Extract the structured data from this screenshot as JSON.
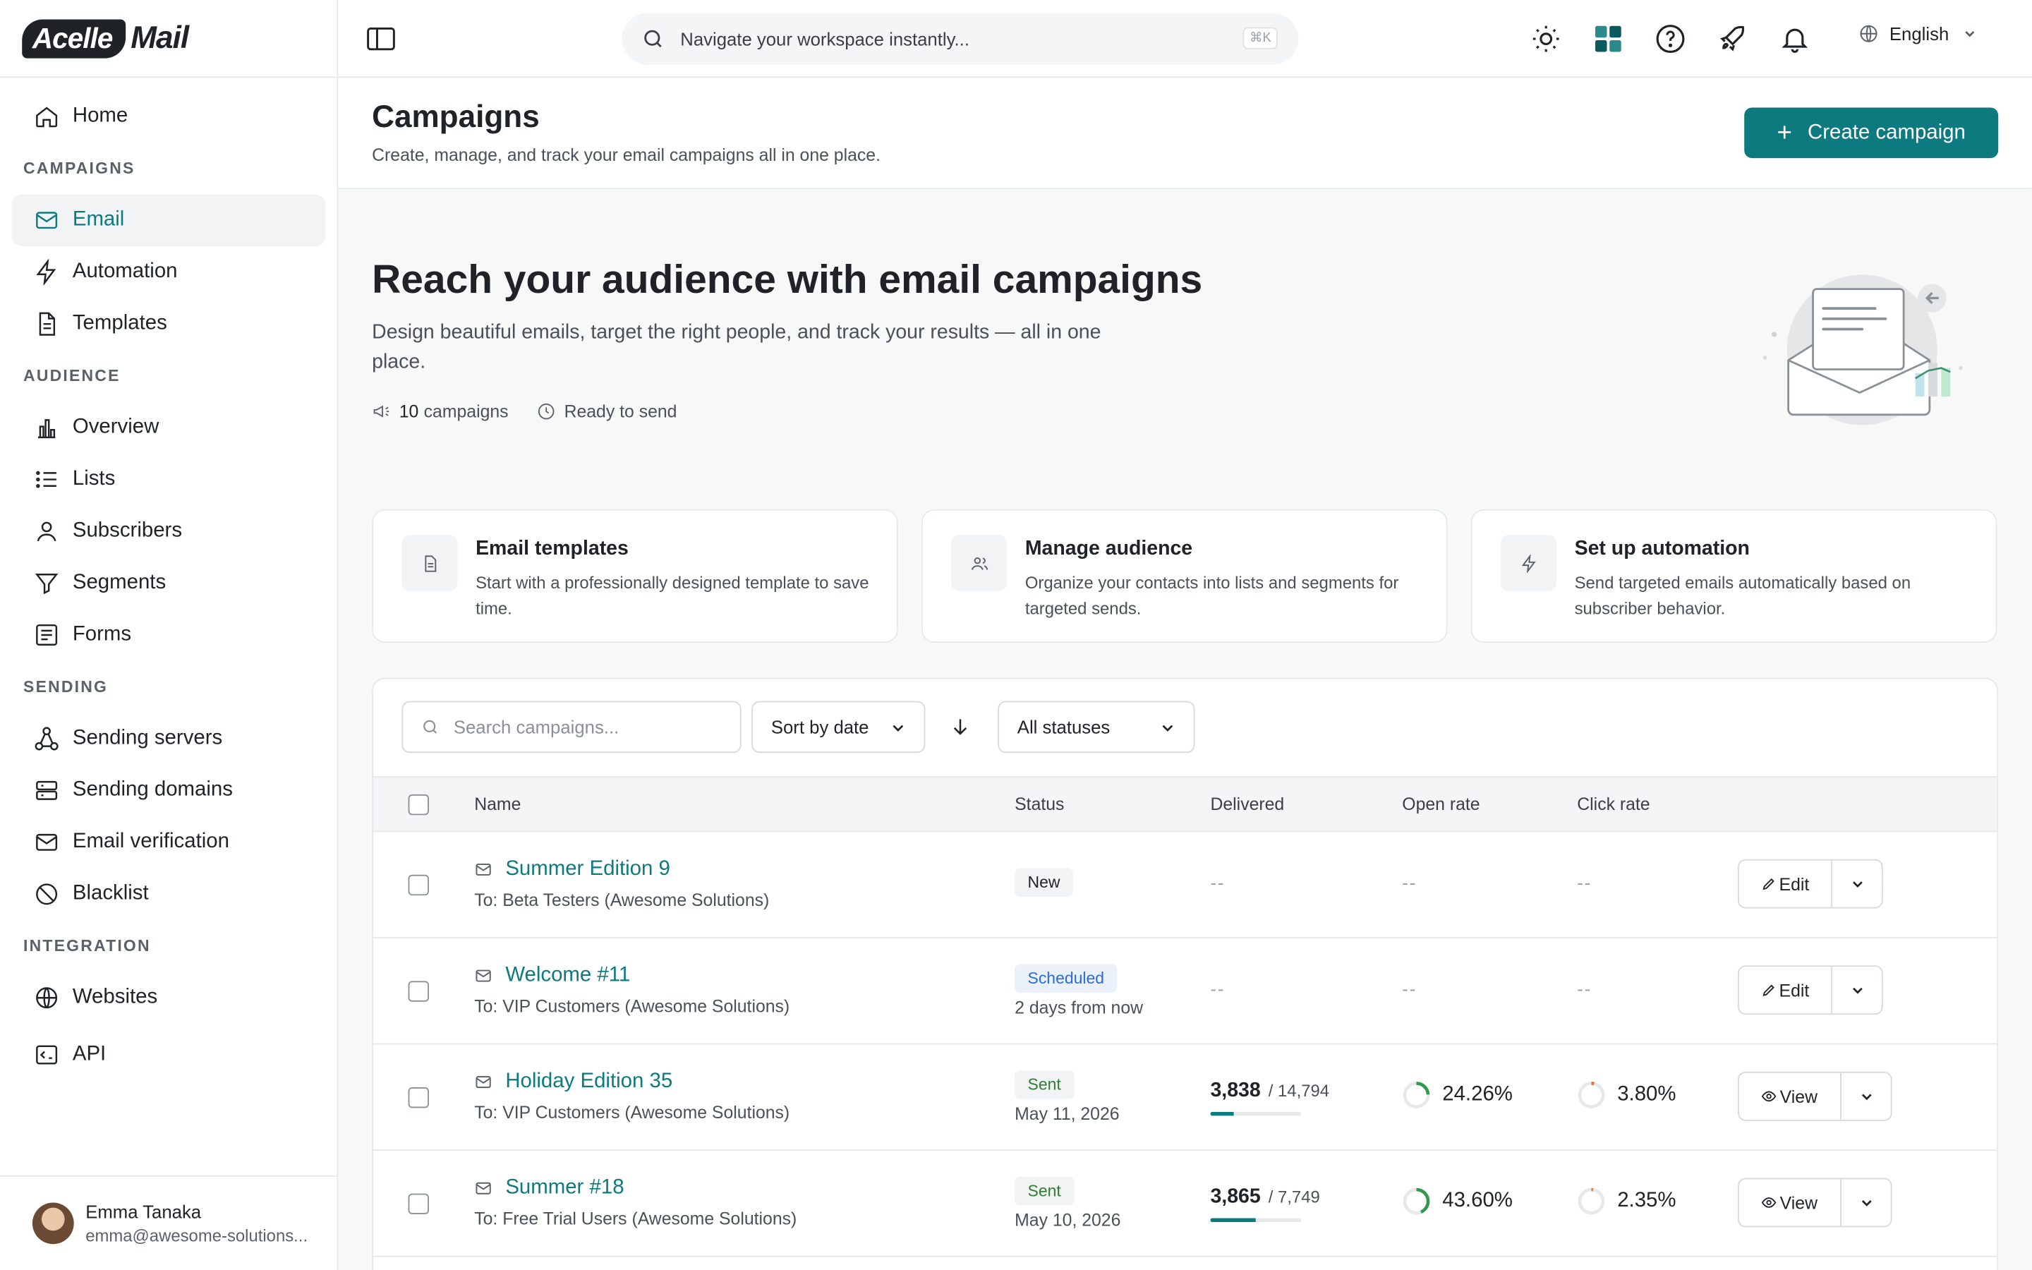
{
  "brand": {
    "logo_badge": "Acelle",
    "logo_text": "Mail"
  },
  "sidebar": {
    "home": "Home",
    "sections": {
      "campaigns": "CAMPAIGNS",
      "audience": "AUDIENCE",
      "sending": "SENDING",
      "integration": "INTEGRATION"
    },
    "campaigns": [
      "Email",
      "Automation",
      "Templates"
    ],
    "audience": [
      "Overview",
      "Lists",
      "Subscribers",
      "Segments",
      "Forms"
    ],
    "sending": [
      "Sending servers",
      "Sending domains",
      "Email verification",
      "Blacklist"
    ],
    "integration": [
      "Websites",
      "API"
    ],
    "user": {
      "name": "Emma Tanaka",
      "email": "emma@awesome-solutions..."
    }
  },
  "topbar": {
    "search_placeholder": "Navigate your workspace instantly...",
    "shortcut": "⌘K",
    "language": "English"
  },
  "page": {
    "title": "Campaigns",
    "subtitle": "Create, manage, and track your email campaigns all in one place.",
    "create_button": "Create campaign"
  },
  "hero": {
    "title": "Reach your audience with email campaigns",
    "subtitle": "Design beautiful emails, target the right people, and track your results — all in one place.",
    "campaign_count": "10",
    "campaign_count_label": "campaigns",
    "ready_label": "Ready to send"
  },
  "cards": [
    {
      "title": "Email templates",
      "desc": "Start with a professionally designed template to save time."
    },
    {
      "title": "Manage audience",
      "desc": "Organize your contacts into lists and segments for targeted sends."
    },
    {
      "title": "Set up automation",
      "desc": "Send targeted emails automatically based on subscriber behavior."
    }
  ],
  "filters": {
    "search_placeholder": "Search campaigns...",
    "sort_label": "Sort by date",
    "status_label": "All statuses"
  },
  "table": {
    "headers": [
      "Name",
      "Status",
      "Delivered",
      "Open rate",
      "Click rate"
    ],
    "empty": "--",
    "rows": [
      {
        "name": "Summer Edition 9",
        "to": "To: Beta Testers (Awesome Solutions)",
        "status": "New",
        "status_sub": "",
        "delivered": "",
        "total": "",
        "delivered_fraction": 0,
        "open_rate": "",
        "open_fraction": 0,
        "click_rate": "",
        "click_fraction": 0,
        "action": "Edit"
      },
      {
        "name": "Welcome #11",
        "to": "To: VIP Customers (Awesome Solutions)",
        "status": "Scheduled",
        "status_sub": "2 days from now",
        "delivered": "",
        "total": "",
        "delivered_fraction": 0,
        "open_rate": "",
        "open_fraction": 0,
        "click_rate": "",
        "click_fraction": 0,
        "action": "Edit"
      },
      {
        "name": "Holiday Edition 35",
        "to": "To: VIP Customers (Awesome Solutions)",
        "status": "Sent",
        "status_sub": "May 11, 2026",
        "delivered": "3,838",
        "total": "/ 14,794",
        "delivered_fraction": 0.26,
        "open_rate": "24.26%",
        "open_fraction": 0.2426,
        "click_rate": "3.80%",
        "click_fraction": 0.038,
        "action": "View"
      },
      {
        "name": "Summer #18",
        "to": "To: Free Trial Users (Awesome Solutions)",
        "status": "Sent",
        "status_sub": "May 10, 2026",
        "delivered": "3,865",
        "total": "/ 7,749",
        "delivered_fraction": 0.5,
        "open_rate": "43.60%",
        "open_fraction": 0.436,
        "click_rate": "2.35%",
        "click_fraction": 0.0235,
        "action": "View"
      }
    ]
  },
  "colors": {
    "accent": "#0d7a80",
    "open_ring": "#2e9a4a",
    "click_ring": "#e8743b"
  }
}
